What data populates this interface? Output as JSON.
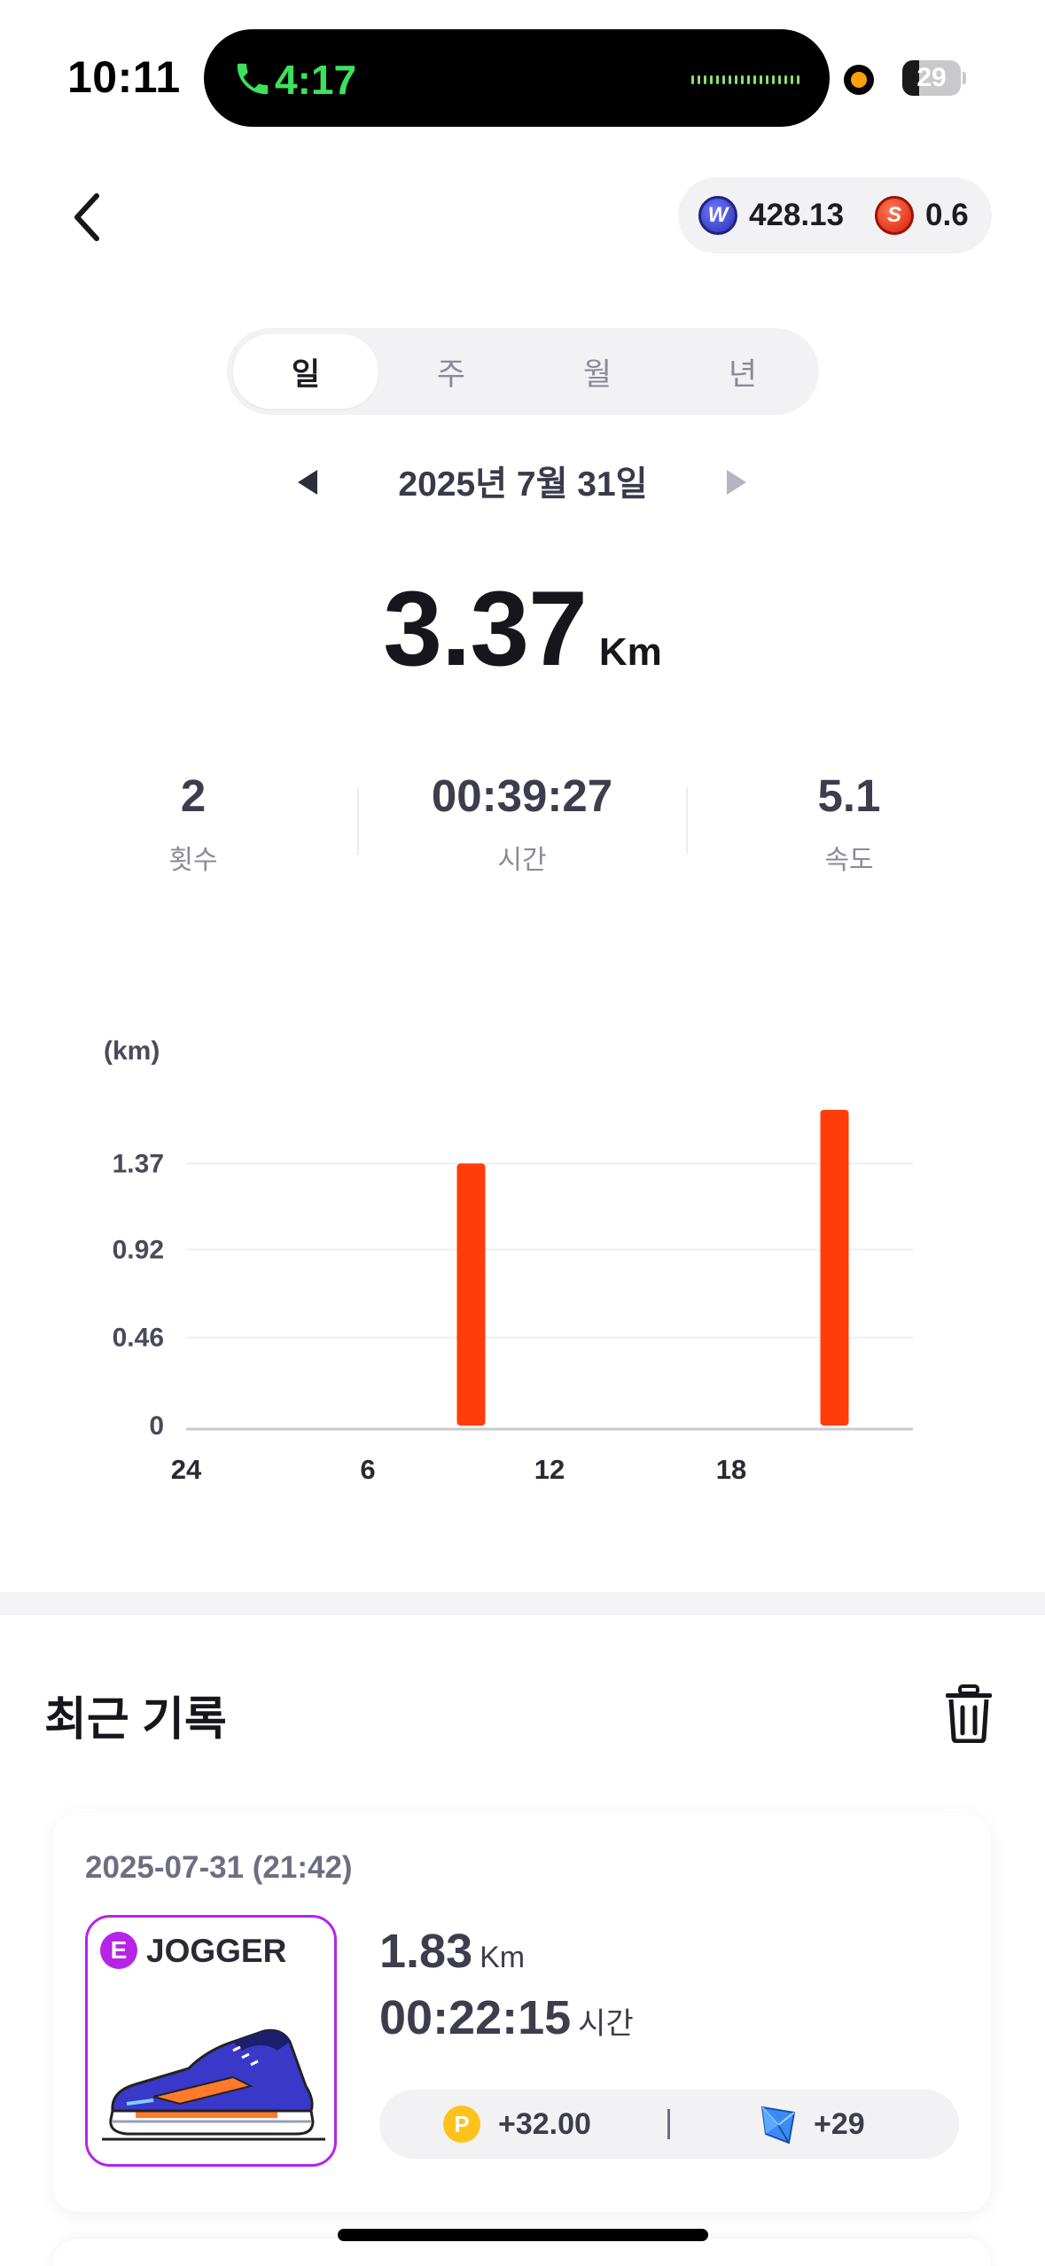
{
  "status_bar": {
    "time": "10:11",
    "call_time": "4:17",
    "battery_level": "29",
    "battery_percent": 29,
    "icons": [
      "phone-icon",
      "mic-indicator",
      "battery-icon"
    ]
  },
  "header": {
    "back_icon": "chevron-left-icon",
    "coins": [
      {
        "icon": "w-coin-icon",
        "letter": "W",
        "value": "428.13",
        "color": "#3a3ec8"
      },
      {
        "icon": "s-coin-icon",
        "letter": "S",
        "value": "0.6",
        "color": "#e8321a"
      }
    ]
  },
  "period_tabs": {
    "items": [
      "일",
      "주",
      "월",
      "년"
    ],
    "selected": "일"
  },
  "date_nav": {
    "label": "2025년 7월 31일",
    "prev_icon": "triangle-left-icon",
    "next_icon": "triangle-right-icon"
  },
  "summary": {
    "distance": "3.37",
    "unit": "Km"
  },
  "stats": [
    {
      "value": "2",
      "label": "횟수"
    },
    {
      "value": "00:39:27",
      "label": "시간"
    },
    {
      "value": "5.1",
      "label": "속도"
    }
  ],
  "chart_data": {
    "type": "bar",
    "ylabel": "(km)",
    "y_ticks": [
      "0",
      "0.46",
      "0.92",
      "1.37"
    ],
    "ylim": [
      0,
      1.37
    ],
    "x_ticks": [
      "24",
      "6",
      "12",
      "18"
    ],
    "x_range": [
      0,
      24
    ],
    "bars": [
      {
        "hour": 9,
        "value": 1.37
      },
      {
        "hour": 21,
        "value": 1.65
      }
    ],
    "bar_color": "#ff3c0a",
    "grid": true
  },
  "recent": {
    "title": "최근 기록",
    "delete_icon": "trash-icon",
    "records": [
      {
        "datetime": "2025-07-31 (21:42)",
        "shoe_grade": "E",
        "shoe_name": "JOGGER",
        "shoe_icon": "running-shoe-image",
        "distance": "1.83",
        "distance_unit": "Km",
        "duration": "00:22:15",
        "duration_unit": "시간",
        "point_letter": "P",
        "points": "+32.00",
        "gem_icon": "gem-icon",
        "gems": "+29",
        "accent_color": "#b624e8"
      }
    ]
  }
}
